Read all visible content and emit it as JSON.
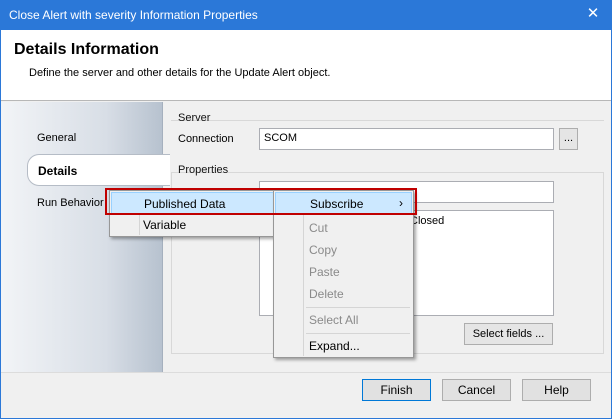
{
  "window": {
    "title": "Close Alert with severity Information Properties"
  },
  "header": {
    "title": "Details Information",
    "subtitle": "Define the server and other details for the Update Alert object."
  },
  "nav": {
    "items": [
      {
        "label": "General"
      },
      {
        "label": "Details"
      },
      {
        "label": "Run Behavior"
      }
    ],
    "active": "Details"
  },
  "server": {
    "group_label": "Server",
    "connection_label": "Connection",
    "connection_value": "SCOM",
    "browse_label": "..."
  },
  "properties": {
    "group_label": "Properties",
    "area_text": "Closed",
    "select_fields_label": "Select fields ..."
  },
  "context_menu": {
    "items": [
      {
        "label": "Published Data"
      },
      {
        "label": "Variable"
      }
    ]
  },
  "sub_menu": {
    "items": [
      {
        "label": "Subscribe",
        "arrow": "›"
      },
      {
        "label": "Cut"
      },
      {
        "label": "Copy"
      },
      {
        "label": "Paste"
      },
      {
        "label": "Delete"
      },
      {
        "label": "Select All"
      },
      {
        "label": "Expand..."
      }
    ]
  },
  "footer": {
    "finish": "Finish",
    "cancel": "Cancel",
    "help": "Help"
  },
  "icons": {
    "close": "close-icon",
    "submenu_arrow": "chevron-right-icon"
  },
  "colors": {
    "titlebar": "#2b78d8",
    "highlight": "#c00000",
    "menu_hover": "#cce8ff"
  }
}
